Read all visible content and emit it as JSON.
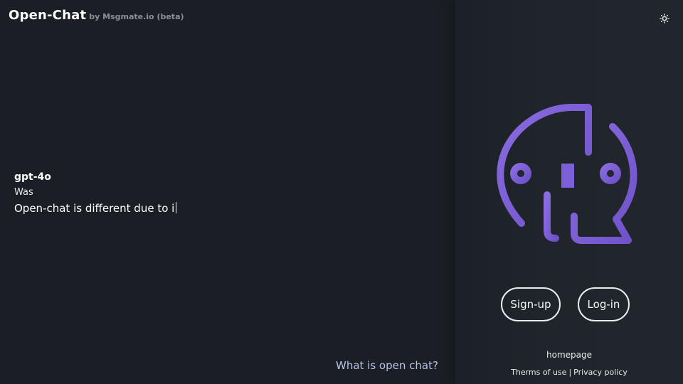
{
  "header": {
    "title": "Open-Chat",
    "subtitle": "by Msgmate.io (beta)",
    "theme_toggle_icon": "sun-icon"
  },
  "chat": {
    "model": "gpt-4o",
    "line1": "Was",
    "typing_text": "Open-chat is different due to i"
  },
  "main": {
    "what_is_link": "What is open chat?"
  },
  "sidebar": {
    "logo_icon": "ai-head-chip-logo",
    "signup_label": "Sign-up",
    "login_label": "Log-in",
    "homepage_link": "homepage",
    "terms_link": "Therms of use",
    "separator": "|",
    "privacy_link": "Privacy policy"
  },
  "colors": {
    "background": "#1b1e24",
    "sidebar_background": "#21262d",
    "logo_purple": "#7c5cd6",
    "text_primary": "#ffffff",
    "subtitle_gray": "#8a8f98",
    "link_blue": "#b7c3e6"
  }
}
